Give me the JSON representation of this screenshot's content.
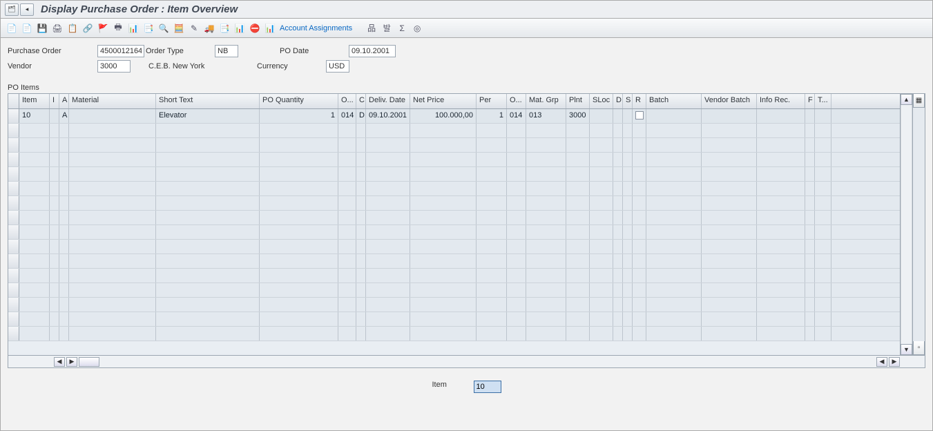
{
  "title": "Display Purchase Order : Item Overview",
  "title_icons": {
    "a": "🗂",
    "b": "◂"
  },
  "toolbar": {
    "btns": [
      "📄",
      "📄",
      "💾",
      "🖨",
      "📋",
      "🔗",
      "🚩",
      "🖶",
      "📊",
      "📑",
      "🔍",
      "🧮",
      "✎",
      "🚚",
      "📑",
      "📊",
      "⛔",
      "📊"
    ],
    "acct_label": "Account Assignments",
    "right_btns": [
      "品",
      "발",
      "Σ",
      "◎"
    ]
  },
  "header": {
    "po_label": "Purchase Order",
    "po_value": "4500012164",
    "order_type_label": "Order Type",
    "order_type_value": "NB",
    "po_date_label": "PO Date",
    "po_date_value": "09.10.2001",
    "vendor_label": "Vendor",
    "vendor_value": "3000",
    "vendor_name": "C.E.B. New York",
    "currency_label": "Currency",
    "currency_value": "USD"
  },
  "section_label": "PO Items",
  "columns": {
    "item": "Item",
    "i": "I",
    "a": "A",
    "material": "Material",
    "short_text": "Short Text",
    "po_qty": "PO Quantity",
    "oun": "O...",
    "c": "C",
    "deliv": "Deliv. Date",
    "net": "Net Price",
    "per": "Per",
    "opu": "O...",
    "mgrp": "Mat. Grp",
    "plnt": "Plnt",
    "sloc": "SLoc",
    "d": "D",
    "s": "S",
    "r": "R",
    "batch": "Batch",
    "vbatch": "Vendor Batch",
    "info": "Info Rec.",
    "f": "F",
    "t": "T..."
  },
  "rows": [
    {
      "item": "10",
      "i": "",
      "a": "A",
      "material": "",
      "short_text": "Elevator",
      "po_qty": "1",
      "oun": "014",
      "c": "D",
      "deliv": "09.10.2001",
      "net": "100.000,00",
      "per": "1",
      "opu": "014",
      "mgrp": "013",
      "plnt": "3000",
      "sloc": "",
      "d": "",
      "s": "",
      "r": "☐",
      "batch": "",
      "vbatch": "",
      "info": "",
      "f": "",
      "t": ""
    }
  ],
  "footer": {
    "item_label": "Item",
    "item_value": "10"
  }
}
